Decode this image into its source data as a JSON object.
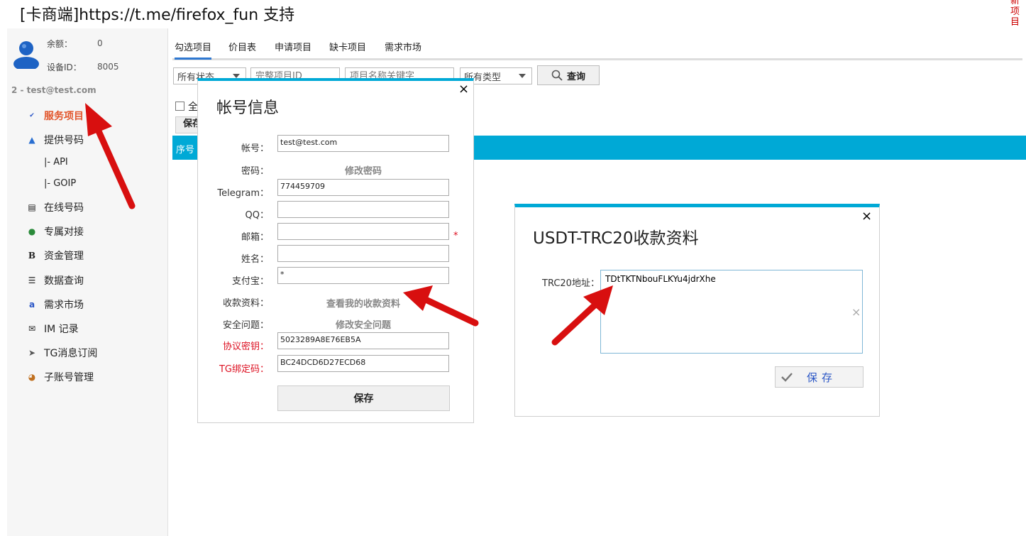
{
  "header": {
    "title_prefix": "[卡商端]",
    "title_url": "https://t.me/firefox_fun",
    "title_suffix": " 支持",
    "new_item": "新项目"
  },
  "sidebar": {
    "balance_label": "余额：",
    "balance_value": "0",
    "device_label": "设备ID：",
    "device_value": "8005",
    "account_line": "2 - test@test.com",
    "items": [
      {
        "label": "服务项目",
        "icon": "abc-check-icon"
      },
      {
        "label": "提供号码",
        "icon": "upload-arrow-icon"
      },
      {
        "label": "|- API"
      },
      {
        "label": "|- GOIP"
      },
      {
        "label": "在线号码",
        "icon": "card-icon"
      },
      {
        "label": "专属对接",
        "icon": "globe-person-icon"
      },
      {
        "label": "资金管理",
        "icon": "bold-b-icon"
      },
      {
        "label": "数据查询",
        "icon": "list-icon"
      },
      {
        "label": "需求市场",
        "icon": "notepad-icon"
      },
      {
        "label": "IM 记录",
        "icon": "envelope-icon"
      },
      {
        "label": "TG消息订阅",
        "icon": "telegram-icon"
      },
      {
        "label": "子账号管理",
        "icon": "users-icon"
      }
    ]
  },
  "tabs": [
    "勾选项目",
    "价目表",
    "申请项目",
    "缺卡项目",
    "需求市场"
  ],
  "filters": {
    "status_value": "所有状态",
    "project_id_placeholder": "完整项目ID",
    "keyword_placeholder": "项目名称关键字",
    "type_value": "所有类型",
    "query_label": "查询"
  },
  "list": {
    "select_all_label": "全",
    "save_label": "保存",
    "header_col1": "序号"
  },
  "account_dialog": {
    "title": "帐号信息",
    "close": "×",
    "fields": {
      "account_label": "帐号：",
      "account_value": "test@test.com",
      "password_label": "密码：",
      "password_link": "修改密码",
      "telegram_label": "Telegram：",
      "telegram_value": "774459709",
      "qq_label": "QQ：",
      "qq_value": "",
      "email_label": "邮箱：",
      "email_value": "",
      "name_label": "姓名：",
      "name_value": "",
      "alipay_label": "支付宝：",
      "alipay_value": "*",
      "payment_label": "收款资料：",
      "payment_link": "查看我的收款资料",
      "security_label": "安全问题：",
      "security_link": "修改安全问题",
      "protocol_key_label": "协议密钥：",
      "protocol_key_value": "5023289A8E76EB5A",
      "tg_bind_label": "TG绑定码：",
      "tg_bind_value": "BC24DCD6D27ECD68"
    },
    "required_mark": "*",
    "save_label": "保存"
  },
  "usdt_dialog": {
    "title": "USDT-TRC20收款资料",
    "close": "×",
    "address_label": "TRC20地址：",
    "address_value": "TDtTKTNbouFLKYu4jdrXhe",
    "clear": "×",
    "save_label": "保存"
  }
}
